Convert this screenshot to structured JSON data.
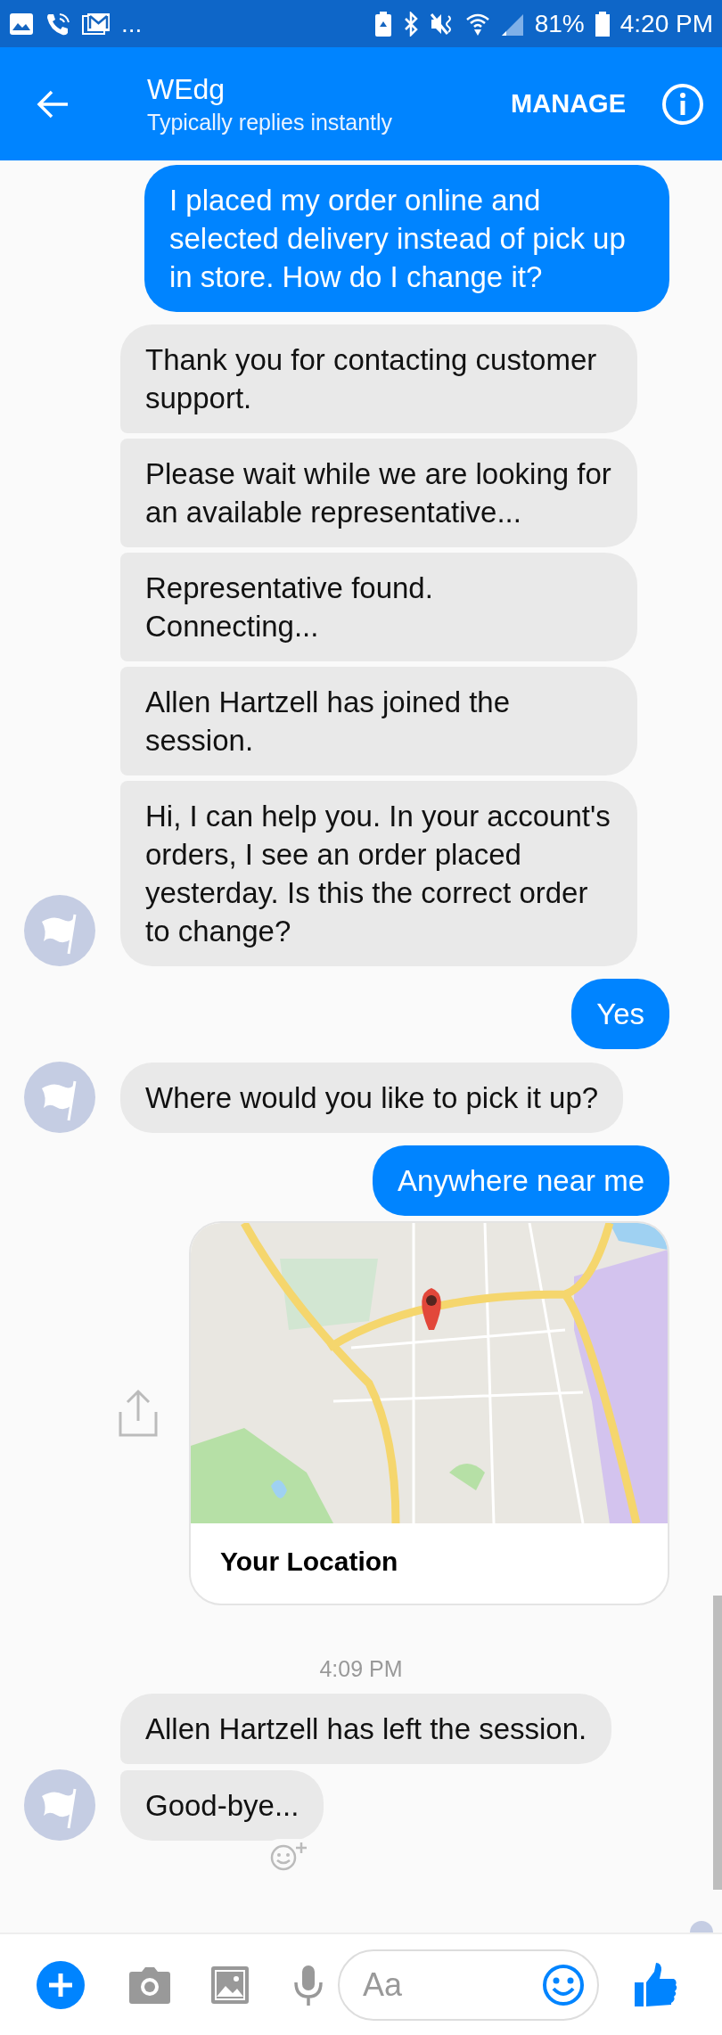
{
  "status_bar": {
    "overflow": "...",
    "battery": "81%",
    "time": "4:20 PM"
  },
  "header": {
    "title": "WEdg",
    "subtitle": "Typically replies instantly",
    "action": "MANAGE"
  },
  "messages": [
    {
      "kind": "outgoing",
      "text": "I placed my order online and selected delivery instead of pick up in store. How do I change it?"
    },
    {
      "kind": "incoming",
      "text": "Thank you for contacting customer support."
    },
    {
      "kind": "incoming",
      "text": "Please wait while we are looking for an available representative..."
    },
    {
      "kind": "incoming",
      "text": "Representative found. Connecting..."
    },
    {
      "kind": "incoming",
      "text": "Allen Hartzell has joined the session."
    },
    {
      "kind": "incoming",
      "text": "Hi, I can help you. In your account's orders, I see an order placed yesterday. Is this the correct order to change?"
    },
    {
      "kind": "outgoing",
      "text": "Yes"
    },
    {
      "kind": "incoming",
      "text": "Where would you like to pick it up?"
    },
    {
      "kind": "outgoing",
      "text": "Anywhere near me"
    },
    {
      "kind": "location",
      "title": "Your Location"
    },
    {
      "kind": "timestamp",
      "text": "4:09 PM"
    },
    {
      "kind": "incoming",
      "text": "Allen Hartzell has left the session."
    },
    {
      "kind": "incoming",
      "text": "Good-bye...",
      "reaction_button": true
    }
  ],
  "composer": {
    "placeholder": "Aa"
  }
}
